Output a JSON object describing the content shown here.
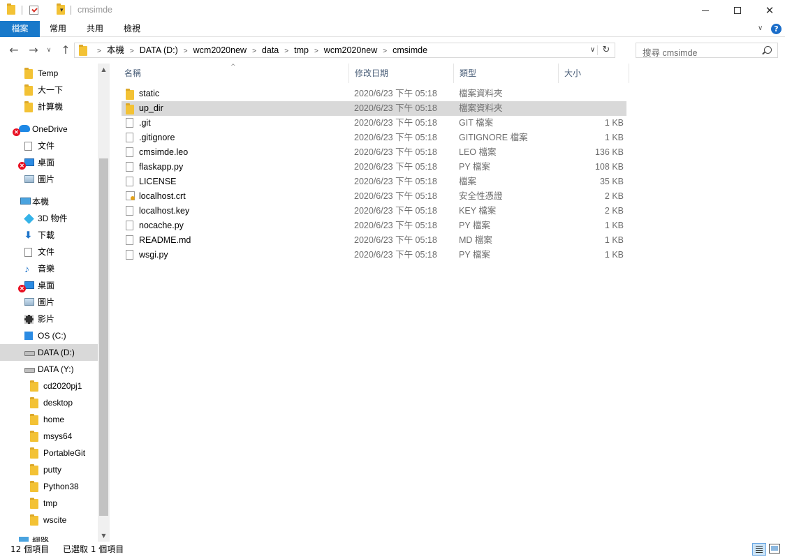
{
  "window": {
    "title": "cmsimde",
    "minimize_glyph": "",
    "maximize_glyph": "",
    "close_glyph": "✕"
  },
  "ribbon": {
    "tabs": [
      {
        "label": "檔案",
        "active": true
      },
      {
        "label": "常用"
      },
      {
        "label": "共用"
      },
      {
        "label": "檢視"
      }
    ],
    "expand_glyph": "∨",
    "help_glyph": "?"
  },
  "nav": {
    "back_glyph": "←",
    "forward_glyph": "→",
    "recent_glyph": "∨",
    "up_glyph": "↑"
  },
  "address": {
    "breadcrumbs": [
      "本機",
      "DATA (D:)",
      "wcm2020new",
      "data",
      "tmp",
      "wcm2020new",
      "cmsimde"
    ],
    "separator": ">",
    "dropdown_glyph": "∨",
    "refresh_glyph": "↻"
  },
  "search": {
    "placeholder": "搜尋 cmsimde"
  },
  "navpane": {
    "items": [
      {
        "label": "Temp",
        "icon": "folder-icon"
      },
      {
        "label": "大一下",
        "icon": "folder-icon"
      },
      {
        "label": "計算機",
        "icon": "folder-icon"
      },
      {
        "label": "OneDrive",
        "icon": "onedrive-icon"
      },
      {
        "label": "文件",
        "icon": "documents-icon"
      },
      {
        "label": "桌面",
        "icon": "desktop-icon"
      },
      {
        "label": "圖片",
        "icon": "pictures-icon"
      },
      {
        "label": "本機",
        "icon": "this-pc-icon"
      },
      {
        "label": "3D 物件",
        "icon": "3d-objects-icon"
      },
      {
        "label": "下載",
        "icon": "downloads-icon"
      },
      {
        "label": "文件",
        "icon": "documents-icon"
      },
      {
        "label": "音樂",
        "icon": "music-icon"
      },
      {
        "label": "桌面",
        "icon": "desktop-icon"
      },
      {
        "label": "圖片",
        "icon": "pictures-icon"
      },
      {
        "label": "影片",
        "icon": "videos-icon"
      },
      {
        "label": "OS (C:)",
        "icon": "windows-drive-icon"
      },
      {
        "label": "DATA (D:)",
        "icon": "drive-icon"
      },
      {
        "label": "DATA (Y:)",
        "icon": "network-drive-icon"
      },
      {
        "label": "cd2020pj1",
        "icon": "folder-icon"
      },
      {
        "label": "desktop",
        "icon": "folder-icon"
      },
      {
        "label": "home",
        "icon": "folder-icon"
      },
      {
        "label": "msys64",
        "icon": "folder-icon"
      },
      {
        "label": "PortableGit",
        "icon": "folder-icon"
      },
      {
        "label": "putty",
        "icon": "folder-icon"
      },
      {
        "label": "Python38",
        "icon": "folder-icon"
      },
      {
        "label": "tmp",
        "icon": "folder-icon"
      },
      {
        "label": "wscite",
        "icon": "folder-icon"
      },
      {
        "label": "網路",
        "icon": "network-icon"
      }
    ],
    "scroll_up_glyph": "▲",
    "scroll_down_glyph": "▼"
  },
  "filelist": {
    "columns": [
      "名稱",
      "修改日期",
      "類型",
      "大小"
    ],
    "sort_glyph": "^",
    "rows": [
      {
        "name": "static",
        "date": "2020/6/23 下午 05:18",
        "type": "檔案資料夾",
        "size": "",
        "icon": "folder-icon"
      },
      {
        "name": "up_dir",
        "date": "2020/6/23 下午 05:18",
        "type": "檔案資料夾",
        "size": "",
        "icon": "folder-icon"
      },
      {
        "name": ".git",
        "date": "2020/6/23 下午 05:18",
        "type": "GIT 檔案",
        "size": "1 KB",
        "icon": "file-icon"
      },
      {
        "name": ".gitignore",
        "date": "2020/6/23 下午 05:18",
        "type": "GITIGNORE 檔案",
        "size": "1 KB",
        "icon": "file-icon"
      },
      {
        "name": "cmsimde.leo",
        "date": "2020/6/23 下午 05:18",
        "type": "LEO 檔案",
        "size": "136 KB",
        "icon": "file-icon"
      },
      {
        "name": "flaskapp.py",
        "date": "2020/6/23 下午 05:18",
        "type": "PY 檔案",
        "size": "108 KB",
        "icon": "file-icon"
      },
      {
        "name": "LICENSE",
        "date": "2020/6/23 下午 05:18",
        "type": "檔案",
        "size": "35 KB",
        "icon": "file-icon"
      },
      {
        "name": "localhost.crt",
        "date": "2020/6/23 下午 05:18",
        "type": "安全性憑證",
        "size": "2 KB",
        "icon": "certificate-icon"
      },
      {
        "name": "localhost.key",
        "date": "2020/6/23 下午 05:18",
        "type": "KEY 檔案",
        "size": "2 KB",
        "icon": "file-icon"
      },
      {
        "name": "nocache.py",
        "date": "2020/6/23 下午 05:18",
        "type": "PY 檔案",
        "size": "1 KB",
        "icon": "file-icon"
      },
      {
        "name": "README.md",
        "date": "2020/6/23 下午 05:18",
        "type": "MD 檔案",
        "size": "1 KB",
        "icon": "file-icon"
      },
      {
        "name": "wsgi.py",
        "date": "2020/6/23 下午 05:18",
        "type": "PY 檔案",
        "size": "1 KB",
        "icon": "file-icon"
      }
    ]
  },
  "status": {
    "item_count": "12 個項目",
    "selection": "已選取 1 個項目"
  },
  "colors": {
    "accent": "#1979ca",
    "selection": "#d9d9d9",
    "folder": "#f3c235",
    "header_text": "#4c607a",
    "muted_text": "#6d6d6d"
  }
}
